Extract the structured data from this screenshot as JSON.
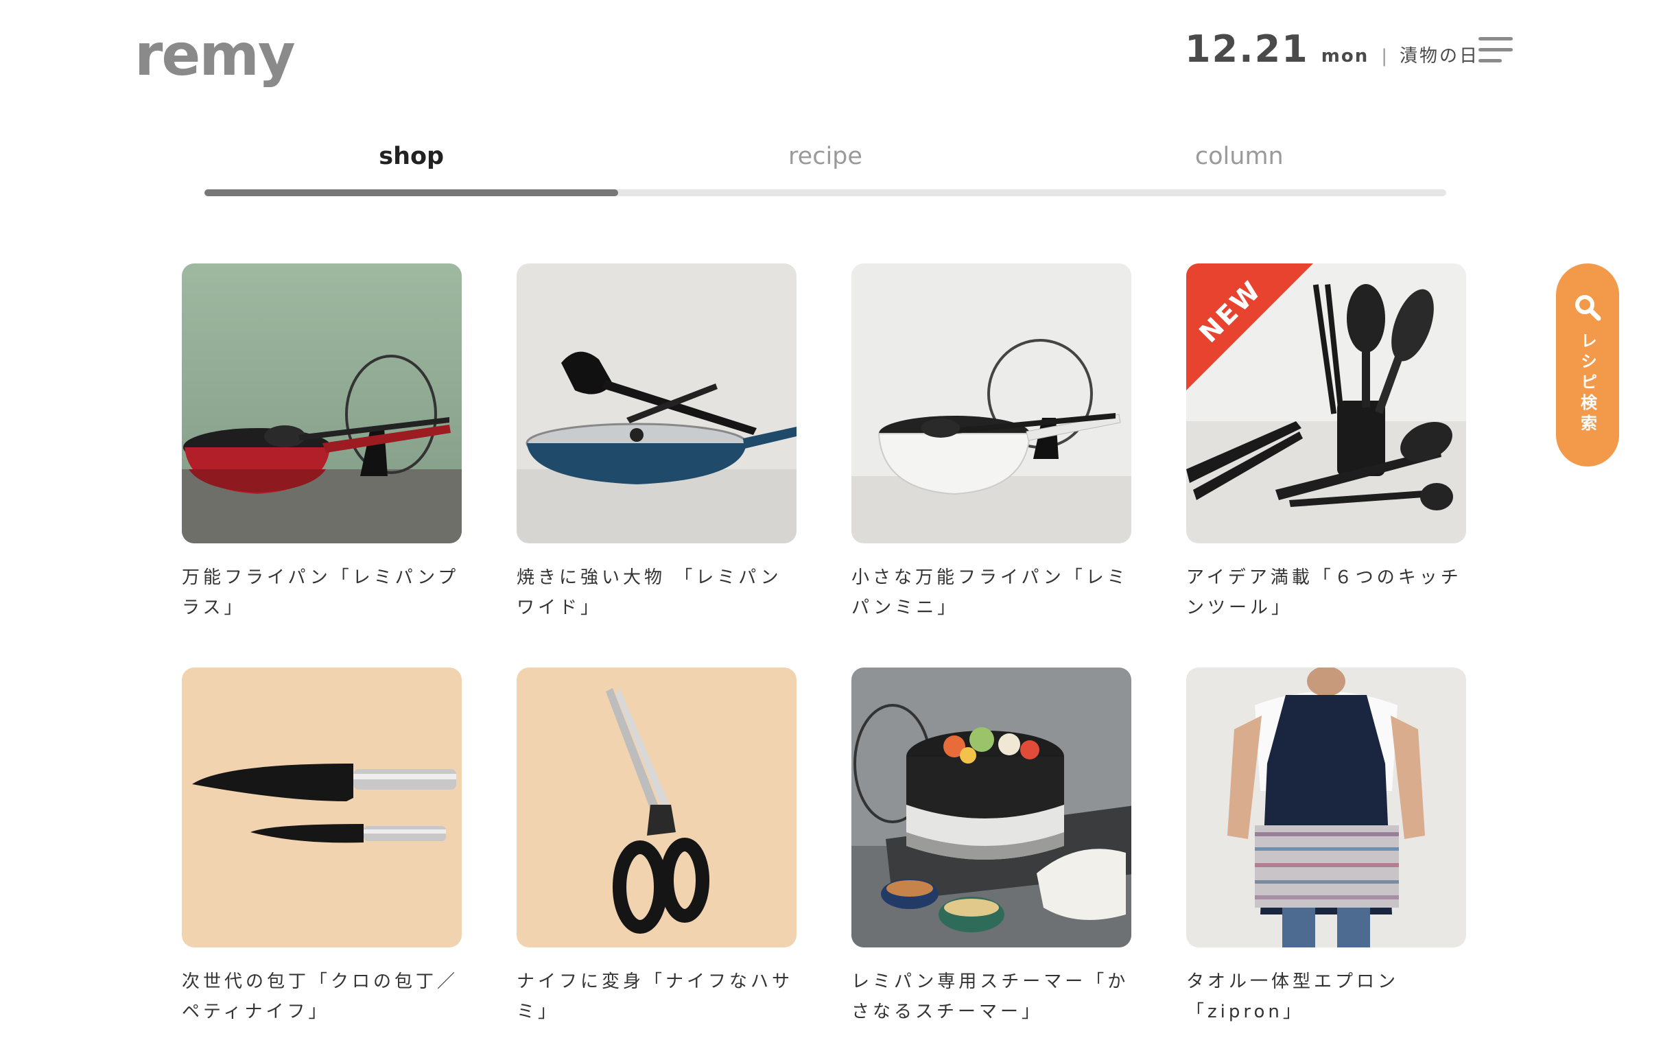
{
  "header": {
    "logo": "remy",
    "date": "12.21",
    "weekday": "mon",
    "separator": "|",
    "day_name": "漬物の日",
    "menu_icon": "hamburger-menu-icon"
  },
  "tabs": [
    {
      "label": "shop",
      "active": true
    },
    {
      "label": "recipe",
      "active": false
    },
    {
      "label": "column",
      "active": false
    }
  ],
  "tab_progress": 0.333,
  "products": [
    {
      "title": "万能フライパン「レミパンプラス」",
      "image": "red-frying-pan-with-lid"
    },
    {
      "title": "焼きに強い大物 「レミパンワイド」",
      "image": "navy-wide-pan-with-spatula"
    },
    {
      "title": "小さな万能フライパン「レミパンミニ」",
      "image": "white-mini-pan-with-lid"
    },
    {
      "title": "アイデア満載「６つのキッチンツール」",
      "image": "black-kitchen-tools",
      "badge": "NEW"
    },
    {
      "title": "次世代の包丁「クロの包丁／ペティナイフ」",
      "image": "black-knives-on-wood"
    },
    {
      "title": "ナイフに変身「ナイフなハサミ」",
      "image": "black-scissors-on-wood"
    },
    {
      "title": "レミパン専用スチーマー「かさなるスチーマー」",
      "image": "steamer-with-vegetables"
    },
    {
      "title": "タオル一体型エプロン「zipron」",
      "image": "person-wearing-apron"
    }
  ],
  "side_search": {
    "label": "レシピ検索",
    "icon": "search-icon",
    "color": "#f2994a"
  }
}
